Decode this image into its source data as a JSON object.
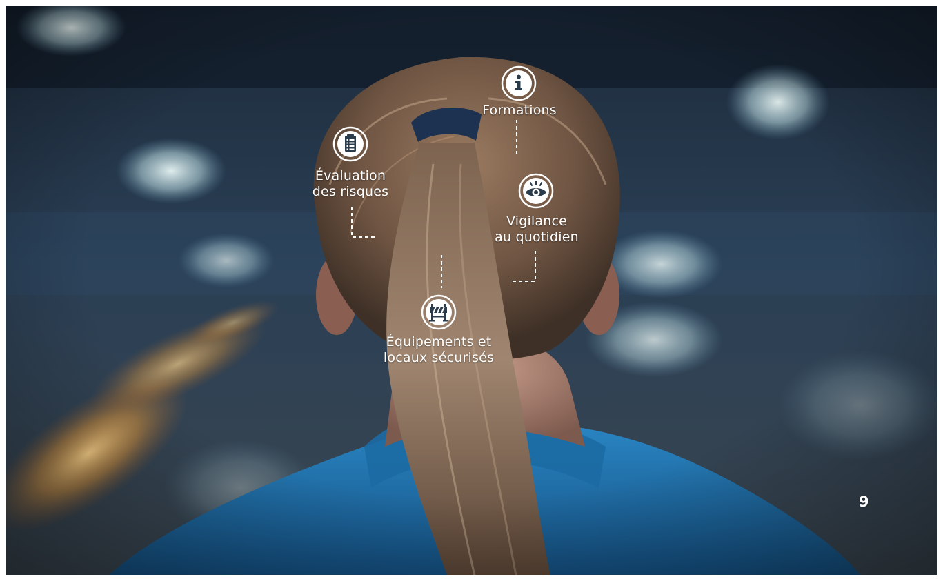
{
  "page_number": "9",
  "items": [
    {
      "id": "formations",
      "lines": [
        "Formations"
      ],
      "icon": "info-icon"
    },
    {
      "id": "evaluation",
      "lines": [
        "Évaluation",
        "des risques"
      ],
      "icon": "checklist-icon"
    },
    {
      "id": "vigilance",
      "lines": [
        "Vigilance",
        "au quotidien"
      ],
      "icon": "eye-icon"
    },
    {
      "id": "equipements",
      "lines": [
        "Équipements et",
        "locaux sécurisés"
      ],
      "icon": "barrier-icon"
    }
  ],
  "colors": {
    "label_text": "#ffffff",
    "shirt_blue": "#1f6fa8",
    "background": "#16273a"
  },
  "background_icon": "photo-woman-ponytail-industrial-workshop"
}
